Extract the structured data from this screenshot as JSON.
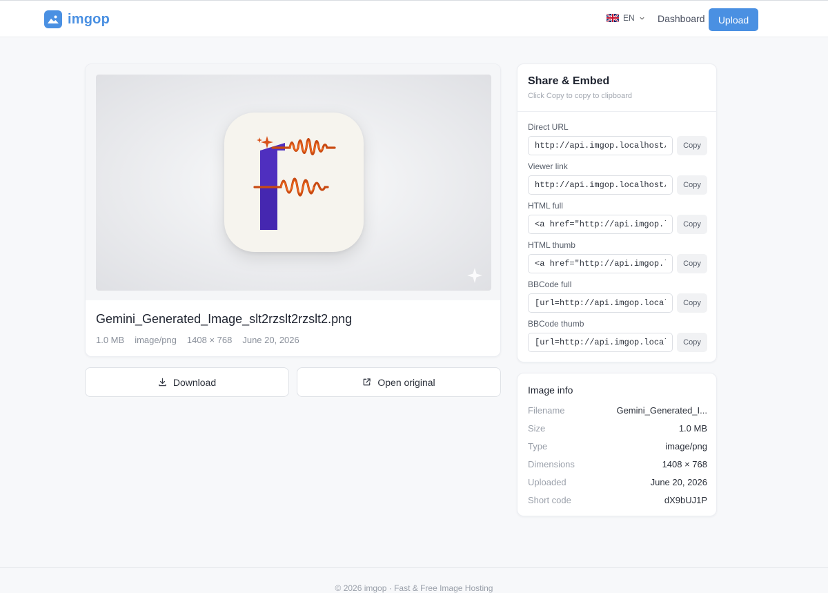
{
  "header": {
    "brand": "imgop",
    "language": "EN",
    "nav_dashboard": "Dashboard",
    "upload_label": "Upload",
    "accent_color": "#4a90e2"
  },
  "image": {
    "filename": "Gemini_Generated_Image_slt2rzslt2rzslt2.png",
    "size": "1.0 MB",
    "type": "image/png",
    "dimensions": "1408 × 768",
    "date": "June 20, 2026"
  },
  "actions": {
    "download_label": "Download",
    "open_original_label": "Open original"
  },
  "share": {
    "title": "Share & Embed",
    "subtitle": "Click Copy to copy to clipboard",
    "copy_label": "Copy",
    "fields": [
      {
        "label": "Direct URL",
        "value": "http://api.imgop.localhost/st"
      },
      {
        "label": "Viewer link",
        "value": "http://api.imgop.localhost/im"
      },
      {
        "label": "HTML full",
        "value": "<a href=\"http://api.imgop.loc"
      },
      {
        "label": "HTML thumb",
        "value": "<a href=\"http://api.imgop.loc"
      },
      {
        "label": "BBCode full",
        "value": "[url=http://api.imgop.localho"
      },
      {
        "label": "BBCode thumb",
        "value": "[url=http://api.imgop.localho"
      }
    ]
  },
  "info": {
    "title": "Image info",
    "rows": [
      {
        "key": "Filename",
        "value": "Gemini_Generated_I..."
      },
      {
        "key": "Size",
        "value": "1.0 MB"
      },
      {
        "key": "Type",
        "value": "image/png"
      },
      {
        "key": "Dimensions",
        "value": "1408 × 768"
      },
      {
        "key": "Uploaded",
        "value": "June 20, 2026"
      },
      {
        "key": "Short code",
        "value": "dX9bUJ1P"
      }
    ]
  },
  "footer": {
    "text": "© 2026 imgop · Fast & Free Image Hosting"
  }
}
